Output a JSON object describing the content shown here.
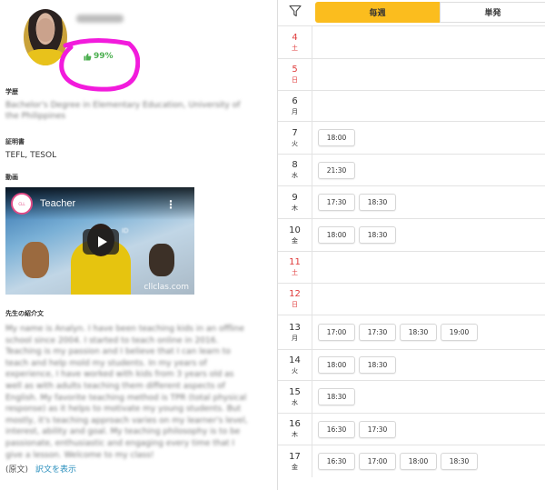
{
  "profile": {
    "rating": "99%",
    "education_label": "学歴",
    "education_value": "Bachelor's Degree in Elementary Education, University of the Philippines",
    "cert_label": "証明書",
    "cert_value": "TEFL, TESOL",
    "video_label": "動画",
    "video_title": "Teacher",
    "video_brand": "cllclas.com",
    "intro_label": "先生の紹介文",
    "intro_text": "My name is Analyn. I have been teaching kids in an offline school since 2004. I started to teach online in 2016. Teaching is my passion and I believe that I can learn to teach and help mold my students. In my years of experience, I have worked with kids from 3 years old as well as with adults teaching them different aspects of English. My favorite teaching method is TPR (total physical response) as it helps to motivate my young students. But mostly, it's teaching approach varies on my learner's level, interest, ability and goal. My teaching philosophy is to be passionate, enthusiastic and engaging every time that I give a lesson. Welcome to my class!",
    "original_label": "(原文)",
    "translate_link": "訳文を表示"
  },
  "tabs": {
    "weekly": "毎週",
    "single": "単発"
  },
  "colors": {
    "accent": "#fbbd1e",
    "weekend": "#e03c3c",
    "rating": "#4caf50",
    "link": "#2a8fbd",
    "annotation": "#f21bdc"
  },
  "schedule": [
    {
      "date": "4",
      "day": "土",
      "weekend": true,
      "slots": []
    },
    {
      "date": "5",
      "day": "日",
      "weekend": true,
      "slots": []
    },
    {
      "date": "6",
      "day": "月",
      "weekend": false,
      "slots": []
    },
    {
      "date": "7",
      "day": "火",
      "weekend": false,
      "slots": [
        "18:00"
      ]
    },
    {
      "date": "8",
      "day": "水",
      "weekend": false,
      "slots": [
        "21:30"
      ]
    },
    {
      "date": "9",
      "day": "木",
      "weekend": false,
      "slots": [
        "17:30",
        "18:30"
      ]
    },
    {
      "date": "10",
      "day": "金",
      "weekend": false,
      "slots": [
        "18:00",
        "18:30"
      ]
    },
    {
      "date": "11",
      "day": "土",
      "weekend": true,
      "slots": []
    },
    {
      "date": "12",
      "day": "日",
      "weekend": true,
      "slots": []
    },
    {
      "date": "13",
      "day": "月",
      "weekend": false,
      "slots": [
        "17:00",
        "17:30",
        "18:30",
        "19:00"
      ]
    },
    {
      "date": "14",
      "day": "火",
      "weekend": false,
      "slots": [
        "18:00",
        "18:30"
      ]
    },
    {
      "date": "15",
      "day": "水",
      "weekend": false,
      "slots": [
        "18:30"
      ]
    },
    {
      "date": "16",
      "day": "木",
      "weekend": false,
      "slots": [
        "16:30",
        "17:30"
      ]
    },
    {
      "date": "17",
      "day": "金",
      "weekend": false,
      "slots": [
        "16:30",
        "17:00",
        "18:00",
        "18:30"
      ]
    }
  ]
}
